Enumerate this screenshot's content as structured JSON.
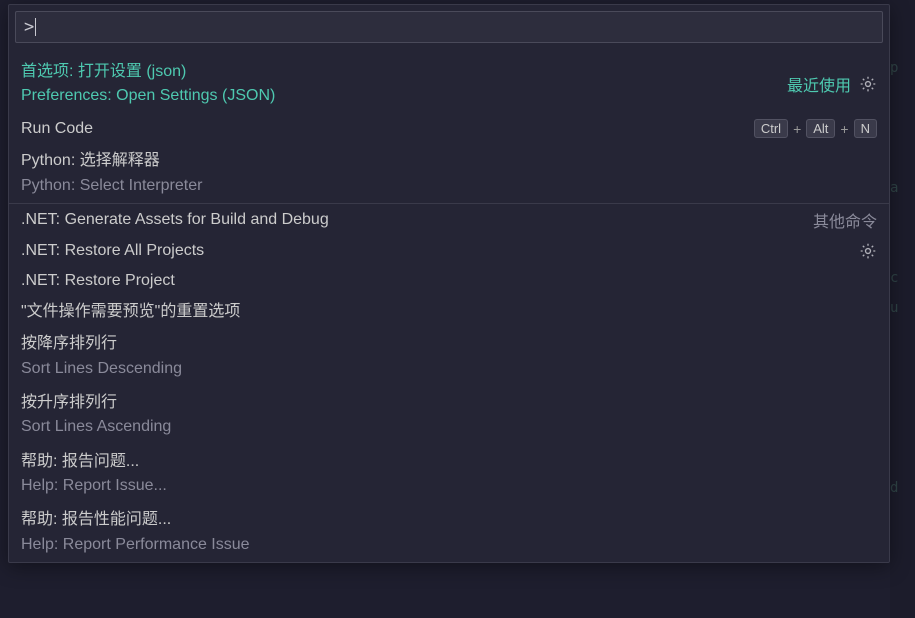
{
  "input": {
    "prefix": ">",
    "value": ""
  },
  "sections": {
    "recent_label": "最近使用",
    "other_label": "其他命令"
  },
  "items": [
    {
      "id": "open-settings-json",
      "label": "首选项: 打开设置 (json)",
      "description": "Preferences: Open Settings (JSON)",
      "labelStyle": "primary",
      "descriptionStyle": "primary",
      "right_label": "recent",
      "gear": true,
      "twoLine": true
    },
    {
      "id": "run-code",
      "label": "Run Code",
      "keybinding": [
        "Ctrl",
        "Alt",
        "N"
      ],
      "twoLine": false
    },
    {
      "id": "python-select-interpreter",
      "label": "Python: 选择解释器",
      "description": "Python: Select Interpreter",
      "descriptionStyle": "muted",
      "twoLine": true
    },
    {
      "id": "separator"
    },
    {
      "id": "dotnet-generate-assets",
      "label": ".NET: Generate Assets for Build and Debug",
      "right_label": "other",
      "twoLine": false
    },
    {
      "id": "dotnet-restore-all",
      "label": ".NET: Restore All Projects",
      "gear": true,
      "twoLine": false
    },
    {
      "id": "dotnet-restore-project",
      "label": ".NET: Restore Project",
      "twoLine": false
    },
    {
      "id": "reset-file-preview",
      "label": "\"文件操作需要预览\"的重置选项",
      "twoLine": false
    },
    {
      "id": "sort-desc",
      "label": "按降序排列行",
      "description": "Sort Lines Descending",
      "descriptionStyle": "muted",
      "twoLine": true
    },
    {
      "id": "sort-asc",
      "label": "按升序排列行",
      "description": "Sort Lines Ascending",
      "descriptionStyle": "muted",
      "twoLine": true
    },
    {
      "id": "help-report-issue",
      "label": "帮助: 报告问题...",
      "description": "Help: Report Issue...",
      "descriptionStyle": "muted",
      "twoLine": true
    },
    {
      "id": "help-report-perf",
      "label": "帮助: 报告性能问题...",
      "description": "Help: Report Performance Issue",
      "descriptionStyle": "muted",
      "twoLine": true
    }
  ],
  "bg_chars": [
    "p",
    "",
    "",
    "",
    "a",
    "",
    "",
    "c",
    "u",
    "",
    "",
    "",
    "",
    "",
    "d"
  ]
}
